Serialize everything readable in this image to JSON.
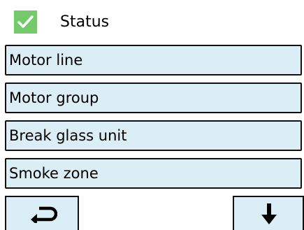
{
  "header": {
    "title": "Status",
    "status_icon": "check-icon",
    "status_color": "#74c96b"
  },
  "menu": {
    "items": [
      {
        "label": "Motor line"
      },
      {
        "label": "Motor group"
      },
      {
        "label": "Break glass unit"
      },
      {
        "label": "Smoke zone"
      }
    ]
  },
  "footer": {
    "back_icon": "return-icon",
    "next_icon": "arrow-down-icon"
  },
  "colors": {
    "item_background": "#dbeef5",
    "border": "#111111"
  }
}
